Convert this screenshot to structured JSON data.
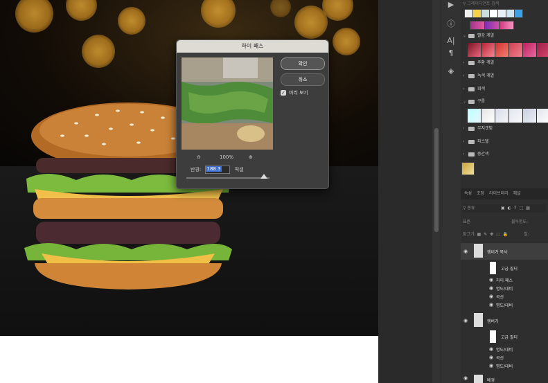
{
  "dialog": {
    "title": "하이 패스",
    "ok_label": "확인",
    "cancel_label": "취소",
    "preview_label": "미리 보기",
    "zoom_level": "100%",
    "radius_label": "반경:",
    "radius_value": "188.3",
    "radius_unit": "픽셀"
  },
  "panel": {
    "search_placeholder": "그레이디언트 검색",
    "gradient_groups": [
      {
        "label": "빨강 계열",
        "expanded": true
      },
      {
        "label": "주황 계열",
        "expanded": false
      },
      {
        "label": "녹색 계열",
        "expanded": false
      },
      {
        "label": "회색",
        "expanded": false
      },
      {
        "label": "구름",
        "expanded": true
      },
      {
        "label": "무지갯빛",
        "expanded": false
      },
      {
        "label": "파스텔",
        "expanded": false
      },
      {
        "label": "중간색",
        "expanded": false
      }
    ],
    "tabs": [
      "속성",
      "조정",
      "라이브러리",
      "채널"
    ],
    "kind_placeholder": "종류",
    "mode_label": "표준",
    "opacity_label": "불투명도:",
    "lock_label": "잠그기:",
    "fill_label": "칠:"
  },
  "layers": [
    {
      "name": "햄버거 복사",
      "type": "layer"
    },
    {
      "name": "고급 필터",
      "type": "filter-group"
    },
    {
      "name": "하이 패스",
      "type": "filter"
    },
    {
      "name": "명도/대비",
      "type": "filter"
    },
    {
      "name": "곡선",
      "type": "filter"
    },
    {
      "name": "명도/대비",
      "type": "filter"
    },
    {
      "name": "햄버거",
      "type": "layer"
    },
    {
      "name": "고급 필터",
      "type": "filter-group"
    },
    {
      "name": "명도/대비",
      "type": "filter"
    },
    {
      "name": "곡선",
      "type": "filter"
    },
    {
      "name": "명도/대비",
      "type": "filter"
    },
    {
      "name": "배경",
      "type": "layer"
    }
  ]
}
